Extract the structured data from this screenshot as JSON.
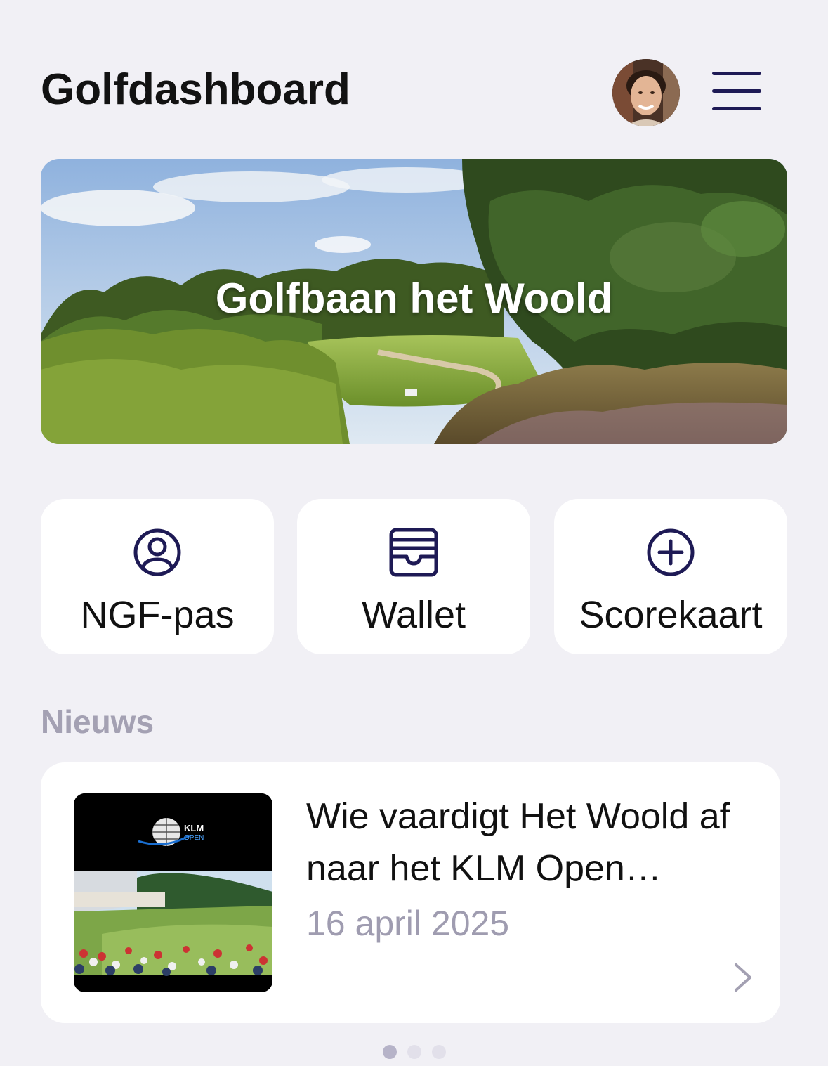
{
  "header": {
    "title": "Golfdashboard",
    "avatar_icon": "user-photo",
    "menu_icon": "hamburger-menu-icon"
  },
  "hero": {
    "title": "Golfbaan het Woold"
  },
  "actions": [
    {
      "label": "NGF-pas",
      "icon": "user-circle-icon"
    },
    {
      "label": "Wallet",
      "icon": "wallet-icon"
    },
    {
      "label": "Scorekaart",
      "icon": "plus-circle-icon"
    }
  ],
  "news": {
    "section_title": "Nieuws",
    "items": [
      {
        "title": "Wie vaardigt Het Woold af naar het KLM Open…",
        "date": "16 april 2025",
        "thumb_logo_line1": "KLM",
        "thumb_logo_line2": "OPEN"
      }
    ]
  },
  "pager": {
    "count": 3,
    "active_index": 0
  },
  "colors": {
    "background": "#f1f0f5",
    "card": "#ffffff",
    "accent_navy": "#1e1a55",
    "muted_text": "#a4a1b3"
  }
}
